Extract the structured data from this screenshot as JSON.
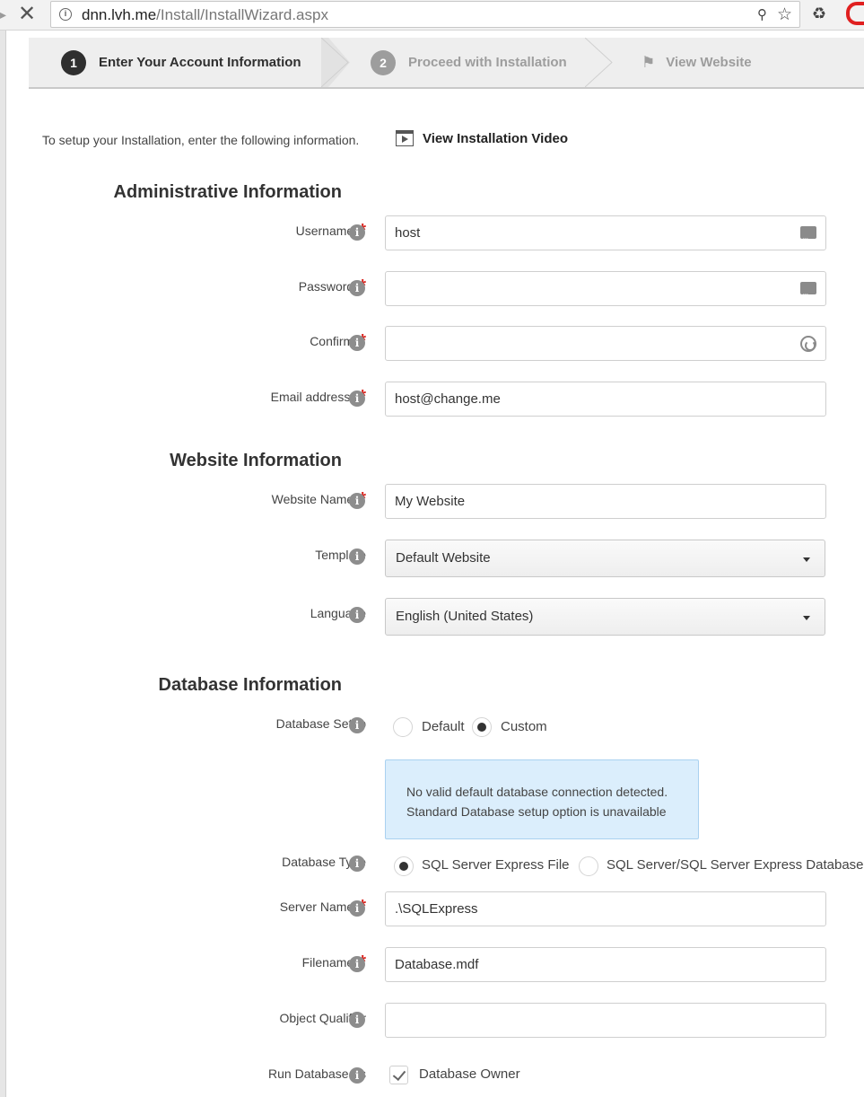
{
  "browser": {
    "url_host": "dnn.lvh.me",
    "url_path": "/Install/InstallWizard.aspx"
  },
  "steps": [
    {
      "num": "1",
      "label": "Enter Your Account Information"
    },
    {
      "num": "2",
      "label": "Proceed with Installation"
    },
    {
      "num": "",
      "label": "View Website"
    }
  ],
  "intro": {
    "text": "To setup your Installation, enter the following information.",
    "video_label": "View Installation Video"
  },
  "admin": {
    "heading": "Administrative Information",
    "username_label": "Username",
    "username_value": "host",
    "password_label": "Password",
    "password_value": "",
    "confirm_label": "Confirm",
    "confirm_value": "",
    "email_label": "Email address:",
    "email_value": "host@change.me"
  },
  "website": {
    "heading": "Website Information",
    "name_label": "Website Name",
    "name_value": "My Website",
    "template_label": "Template",
    "template_value": "Default Website",
    "language_label": "Language",
    "language_value": "English (United States)"
  },
  "database": {
    "heading": "Database Information",
    "setup_label": "Database Setup",
    "setup_options": [
      "Default",
      "Custom"
    ],
    "setup_selected": "Custom",
    "notice_line1": "No valid default database connection detected.",
    "notice_line2": "Standard Database setup option is unavailable",
    "type_label": "Database Type",
    "type_options": [
      "SQL Server Express File",
      "SQL Server/SQL Server Express Database"
    ],
    "type_selected": "SQL Server Express File",
    "server_label": "Server Name",
    "server_value": ".\\SQLExpress",
    "filename_label": "Filename",
    "filename_value": "Database.mdf",
    "qualifier_label": "Object Qualifier",
    "qualifier_value": "",
    "runas_label": "Run Database As",
    "runas_option": "Database Owner",
    "runas_checked": true
  },
  "required_mark": "*",
  "info_glyph": "i",
  "colors": {
    "required": "#d9231d",
    "notice_bg": "#dbeefc",
    "active_step": "#2f2f2f",
    "inactive_step": "#9d9d9d"
  }
}
